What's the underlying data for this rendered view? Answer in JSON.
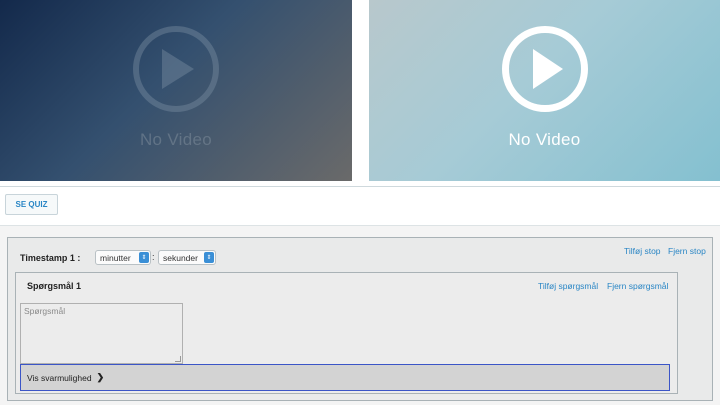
{
  "videos": [
    {
      "label": "No Video",
      "icon": "play-icon"
    },
    {
      "label": "No Video",
      "icon": "play-icon"
    }
  ],
  "toolbar": {
    "quiz_button": "SE QUIZ"
  },
  "timestamp": {
    "label": "Timestamp 1 :",
    "minutes_select": "minutter",
    "seconds_select": "sekunder",
    "separator": ":",
    "add_stop": "Tilføj stop",
    "remove_stop": "Fjern stop"
  },
  "question": {
    "title": "Spørgsmål 1",
    "add_question": "Tilføj spørgsmål",
    "remove_question": "Fjern spørgsmål",
    "input_placeholder": "Spørgsmål",
    "answers_toggle": "Vis svarmulighed"
  },
  "colors": {
    "accent": "#2a86c5",
    "select_button": "#3a8fd6",
    "focus_border": "#3b55c7"
  }
}
